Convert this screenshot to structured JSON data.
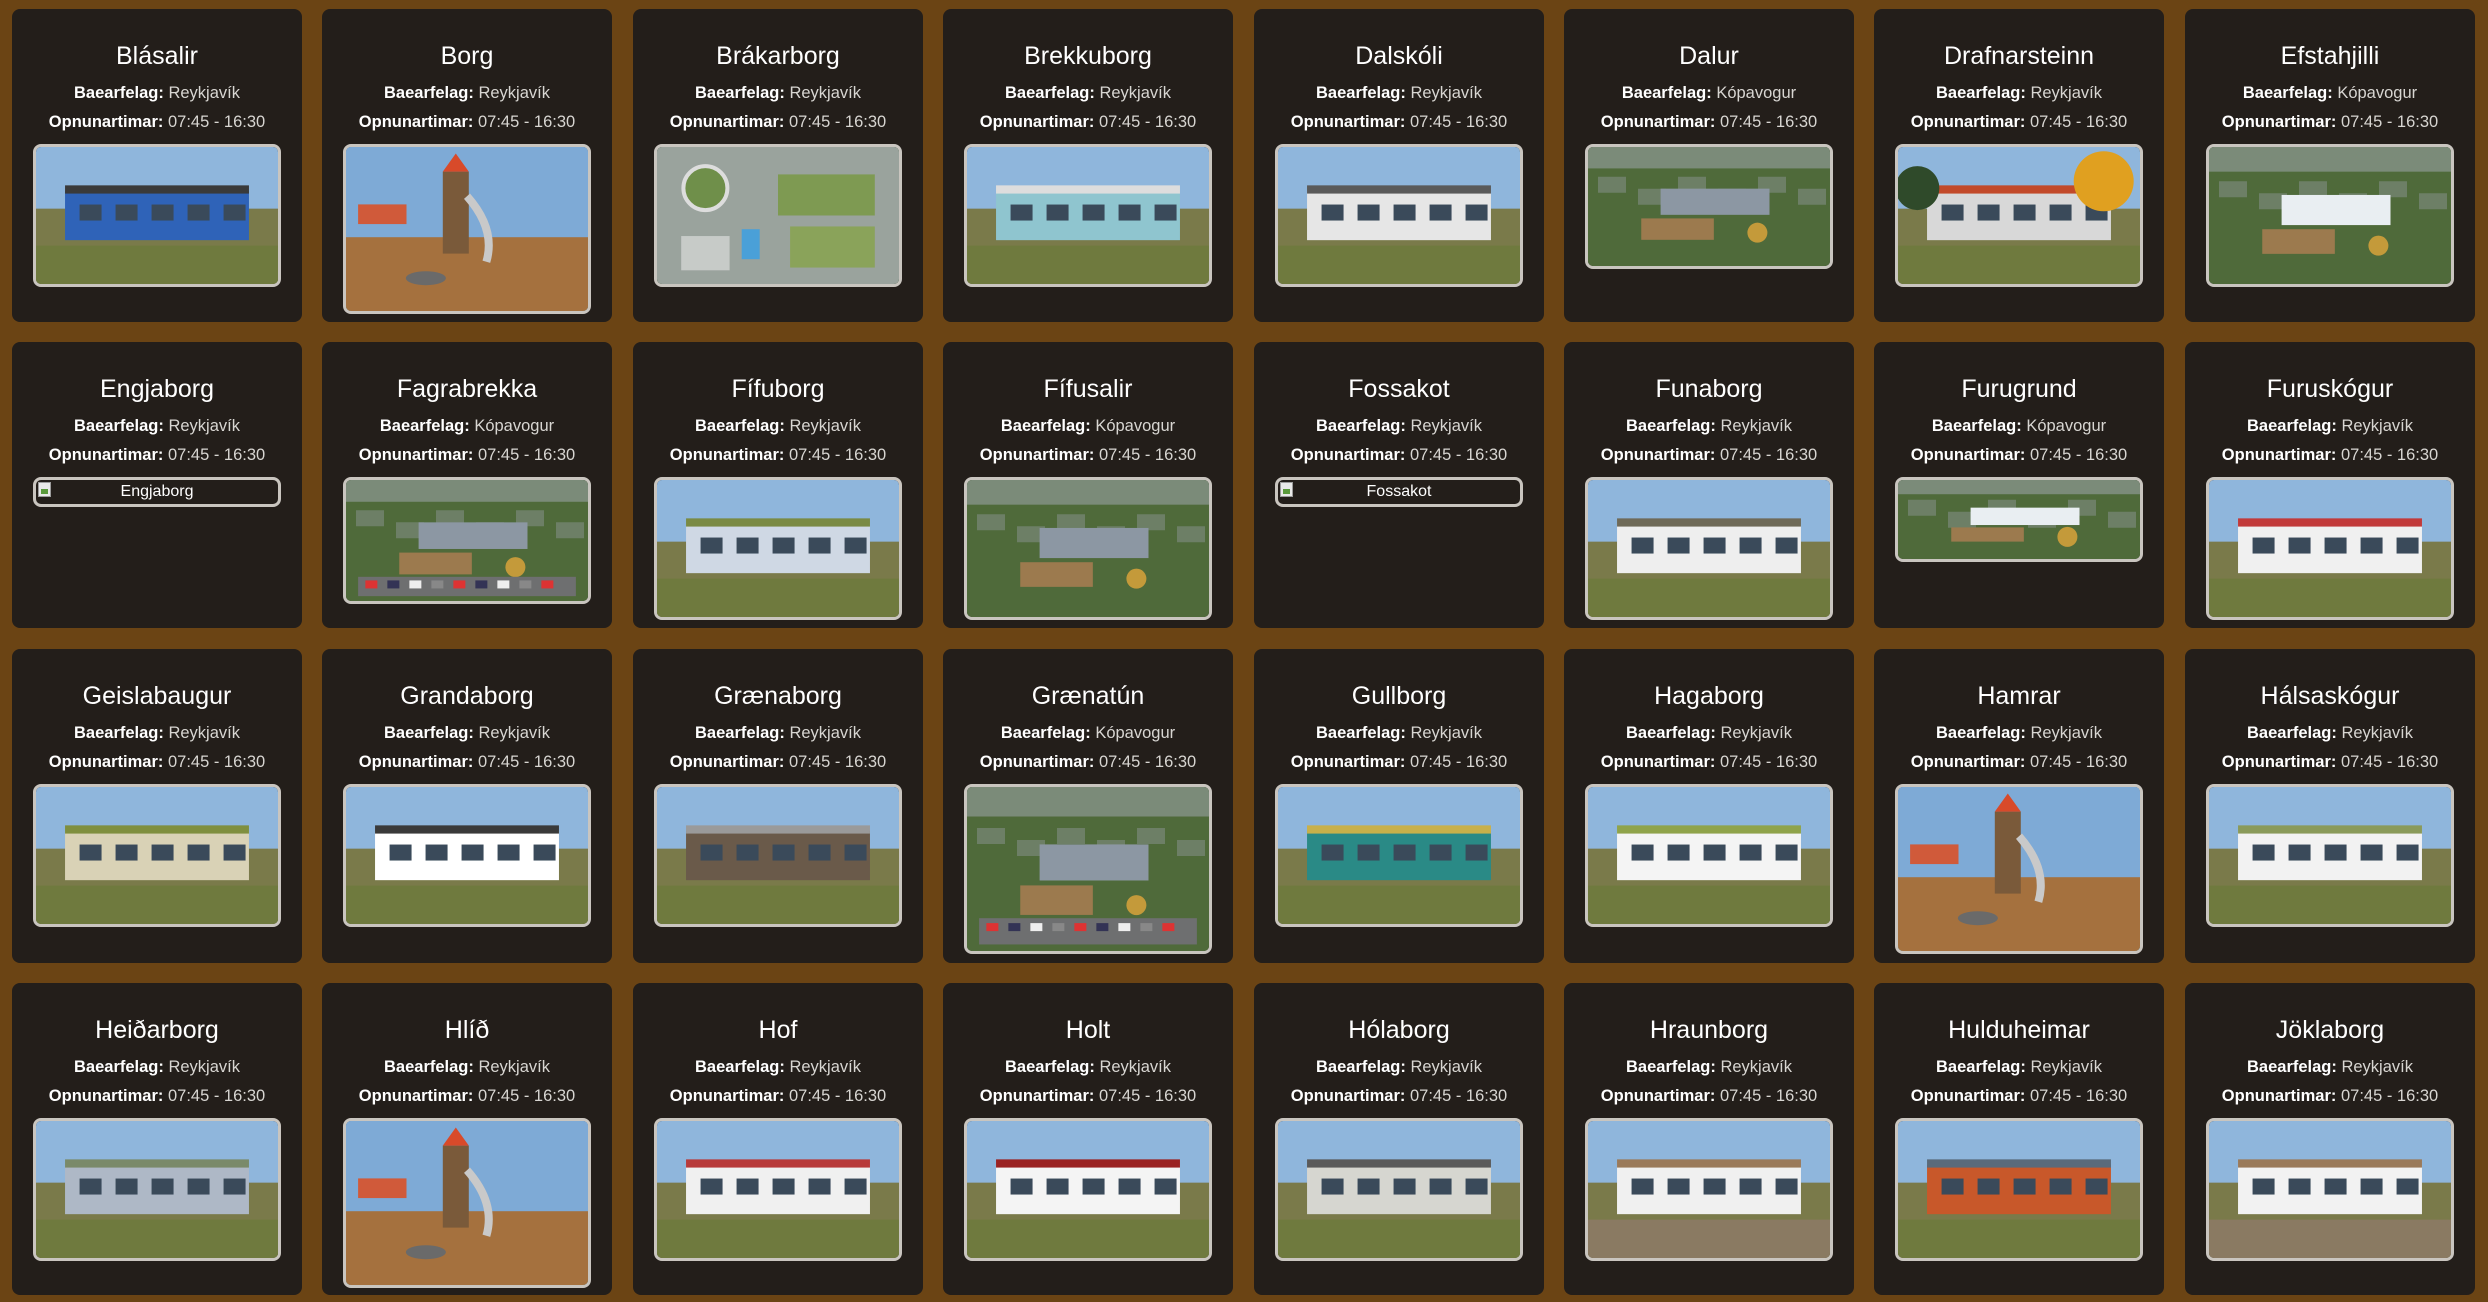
{
  "labels": {
    "municipality": "Baearfelag:",
    "hours": "Opnunartimar:"
  },
  "colors": {
    "page_background": "#6b4414",
    "card_background": "#231e1a",
    "photo_border": "#c9c5bf"
  },
  "icons": {
    "broken_image": "broken-image-icon"
  },
  "kindergartens": [
    {
      "name": "Blásalir",
      "municipality": "Reykjavík",
      "hours": "07:45 - 16:30",
      "photo": "blue-building",
      "photo_alt": ""
    },
    {
      "name": "Borg",
      "municipality": "Reykjavík",
      "hours": "07:45 - 16:30",
      "photo": "playground-tower",
      "photo_alt": ""
    },
    {
      "name": "Brákarborg",
      "municipality": "Reykjavík",
      "hours": "07:45 - 16:30",
      "photo": "aerial-green-roof",
      "photo_alt": ""
    },
    {
      "name": "Brekkuborg",
      "municipality": "Reykjavík",
      "hours": "07:45 - 16:30",
      "photo": "teal-house",
      "photo_alt": ""
    },
    {
      "name": "Dalskóli",
      "municipality": "Reykjavík",
      "hours": "07:45 - 16:30",
      "photo": "grey-modern-building",
      "photo_alt": ""
    },
    {
      "name": "Dalur",
      "municipality": "Kópavogur",
      "hours": "07:45 - 16:30",
      "photo": "aerial-playground",
      "photo_alt": ""
    },
    {
      "name": "Drafnarsteinn",
      "municipality": "Reykjavík",
      "hours": "07:45 - 16:30",
      "photo": "autumn-swings",
      "photo_alt": ""
    },
    {
      "name": "Efstahjilli",
      "municipality": "Kópavogur",
      "hours": "07:45 - 16:30",
      "photo": "aerial-white-roof",
      "photo_alt": ""
    },
    {
      "name": "Engjaborg",
      "municipality": "Reykjavík",
      "hours": "07:45 - 16:30",
      "photo": "",
      "photo_alt": "Engjaborg"
    },
    {
      "name": "Fagrabrekka",
      "municipality": "Kópavogur",
      "hours": "07:45 - 16:30",
      "photo": "aerial-parking",
      "photo_alt": ""
    },
    {
      "name": "Fífuborg",
      "municipality": "Reykjavík",
      "hours": "07:45 - 16:30",
      "photo": "mural-building",
      "photo_alt": ""
    },
    {
      "name": "Fífusalir",
      "municipality": "Kópavogur",
      "hours": "07:45 - 16:30",
      "photo": "aerial-neighborhood",
      "photo_alt": ""
    },
    {
      "name": "Fossakot",
      "municipality": "Reykjavík",
      "hours": "07:45 - 16:30",
      "photo": "",
      "photo_alt": "Fossakot"
    },
    {
      "name": "Funaborg",
      "municipality": "Reykjavík",
      "hours": "07:45 - 16:30",
      "photo": "white-modern-house",
      "photo_alt": ""
    },
    {
      "name": "Furugrund",
      "municipality": "Kópavogur",
      "hours": "07:45 - 16:30",
      "photo": "aerial-low-building",
      "photo_alt": ""
    },
    {
      "name": "Furuskógur",
      "municipality": "Reykjavík",
      "hours": "07:45 - 16:30",
      "photo": "red-roof-yard",
      "photo_alt": ""
    },
    {
      "name": "Geislabaugur",
      "municipality": "Reykjavík",
      "hours": "07:45 - 16:30",
      "photo": "flat-building-lawn",
      "photo_alt": ""
    },
    {
      "name": "Grandaborg",
      "municipality": "Reykjavík",
      "hours": "07:45 - 16:30",
      "photo": "entrance-porch",
      "photo_alt": ""
    },
    {
      "name": "Grænaborg",
      "municipality": "Reykjavík",
      "hours": "07:45 - 16:30",
      "photo": "brown-building-street",
      "photo_alt": ""
    },
    {
      "name": "Grænatún",
      "municipality": "Kópavogur",
      "hours": "07:45 - 16:30",
      "photo": "aerial-parking-lot",
      "photo_alt": ""
    },
    {
      "name": "Gullborg",
      "municipality": "Reykjavík",
      "hours": "07:45 - 16:30",
      "photo": "teal-playground",
      "photo_alt": ""
    },
    {
      "name": "Hagaborg",
      "municipality": "Reykjavík",
      "hours": "07:45 - 16:30",
      "photo": "white-building-kids",
      "photo_alt": ""
    },
    {
      "name": "Hamrar",
      "municipality": "Reykjavík",
      "hours": "07:45 - 16:30",
      "photo": "playground-tower",
      "photo_alt": ""
    },
    {
      "name": "Hálsaskógur",
      "municipality": "Reykjavík",
      "hours": "07:45 - 16:30",
      "photo": "white-building-road",
      "photo_alt": ""
    },
    {
      "name": "Heiðarborg",
      "municipality": "Reykjavík",
      "hours": "07:45 - 16:30",
      "photo": "grey-building-toys",
      "photo_alt": ""
    },
    {
      "name": "Hlíð",
      "municipality": "Reykjavík",
      "hours": "07:45 - 16:30",
      "photo": "playground-tower",
      "photo_alt": ""
    },
    {
      "name": "Hof",
      "municipality": "Reykjavík",
      "hours": "07:45 - 16:30",
      "photo": "red-white-building",
      "photo_alt": ""
    },
    {
      "name": "Holt",
      "municipality": "Reykjavík",
      "hours": "07:45 - 16:30",
      "photo": "red-porch-house",
      "photo_alt": ""
    },
    {
      "name": "Hólaborg",
      "municipality": "Reykjavík",
      "hours": "07:45 - 16:30",
      "photo": "long-building-lot",
      "photo_alt": ""
    },
    {
      "name": "Hraunborg",
      "municipality": "Reykjavík",
      "hours": "07:45 - 16:30",
      "photo": "blue-roof-sandbox",
      "photo_alt": ""
    },
    {
      "name": "Hulduheimar",
      "municipality": "Reykjavík",
      "hours": "07:45 - 16:30",
      "photo": "orange-panel-building",
      "photo_alt": ""
    },
    {
      "name": "Jöklaborg",
      "municipality": "Reykjavík",
      "hours": "07:45 - 16:30",
      "photo": "blue-roof-fence",
      "photo_alt": ""
    }
  ]
}
